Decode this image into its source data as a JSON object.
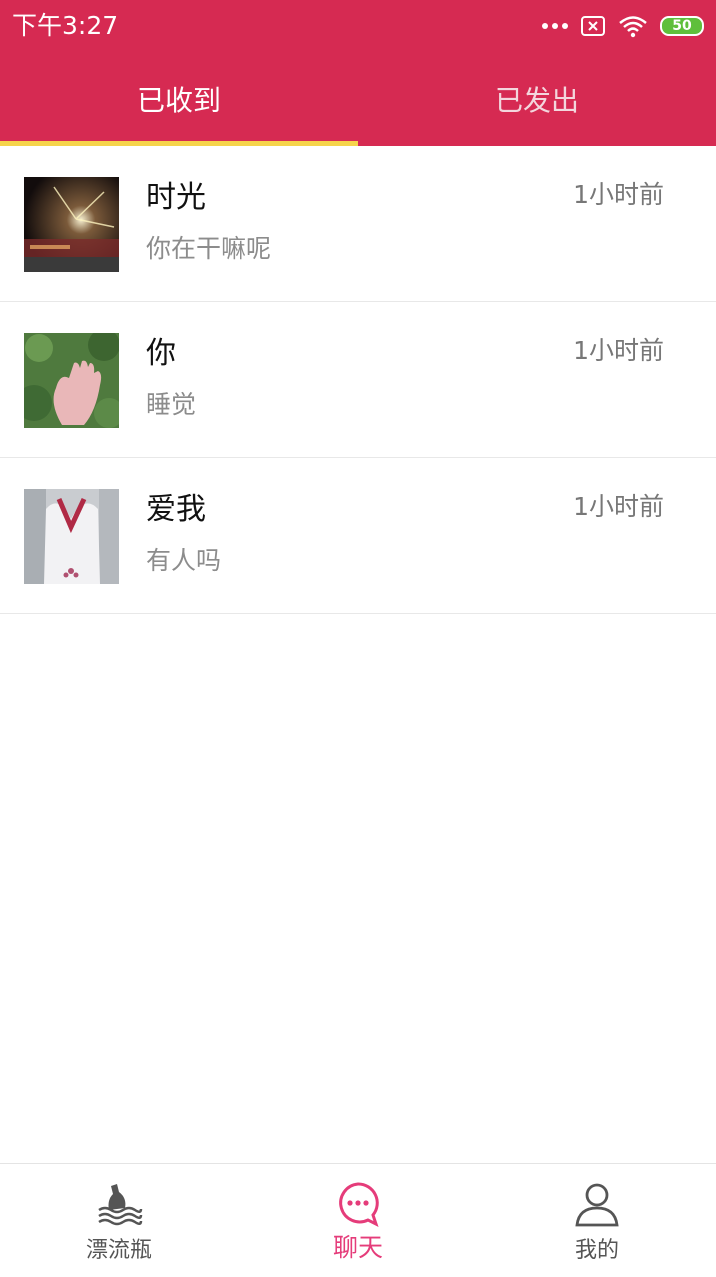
{
  "statusbar": {
    "time": "下午3:27",
    "battery_level": "50",
    "icons": [
      "more-dots-icon",
      "no-sim-icon",
      "wifi-icon",
      "battery-icon"
    ]
  },
  "tabs": [
    {
      "label": "已收到",
      "active": true
    },
    {
      "label": "已发出",
      "active": false
    }
  ],
  "messages": [
    {
      "name": "时光",
      "preview": "你在干嘛呢",
      "time": "1小时前"
    },
    {
      "name": "你",
      "preview": "睡觉",
      "time": "1小时前"
    },
    {
      "name": "爱我",
      "preview": "有人吗",
      "time": "1小时前"
    }
  ],
  "bottom_nav": [
    {
      "label": "漂流瓶",
      "icon": "bottle-icon",
      "active": false
    },
    {
      "label": "聊天",
      "icon": "chat-icon",
      "active": true
    },
    {
      "label": "我的",
      "icon": "user-icon",
      "active": false
    }
  ],
  "colors": {
    "header": "#D62A52",
    "tab_indicator": "#F6D44B",
    "active_nav": "#E53C7A"
  }
}
